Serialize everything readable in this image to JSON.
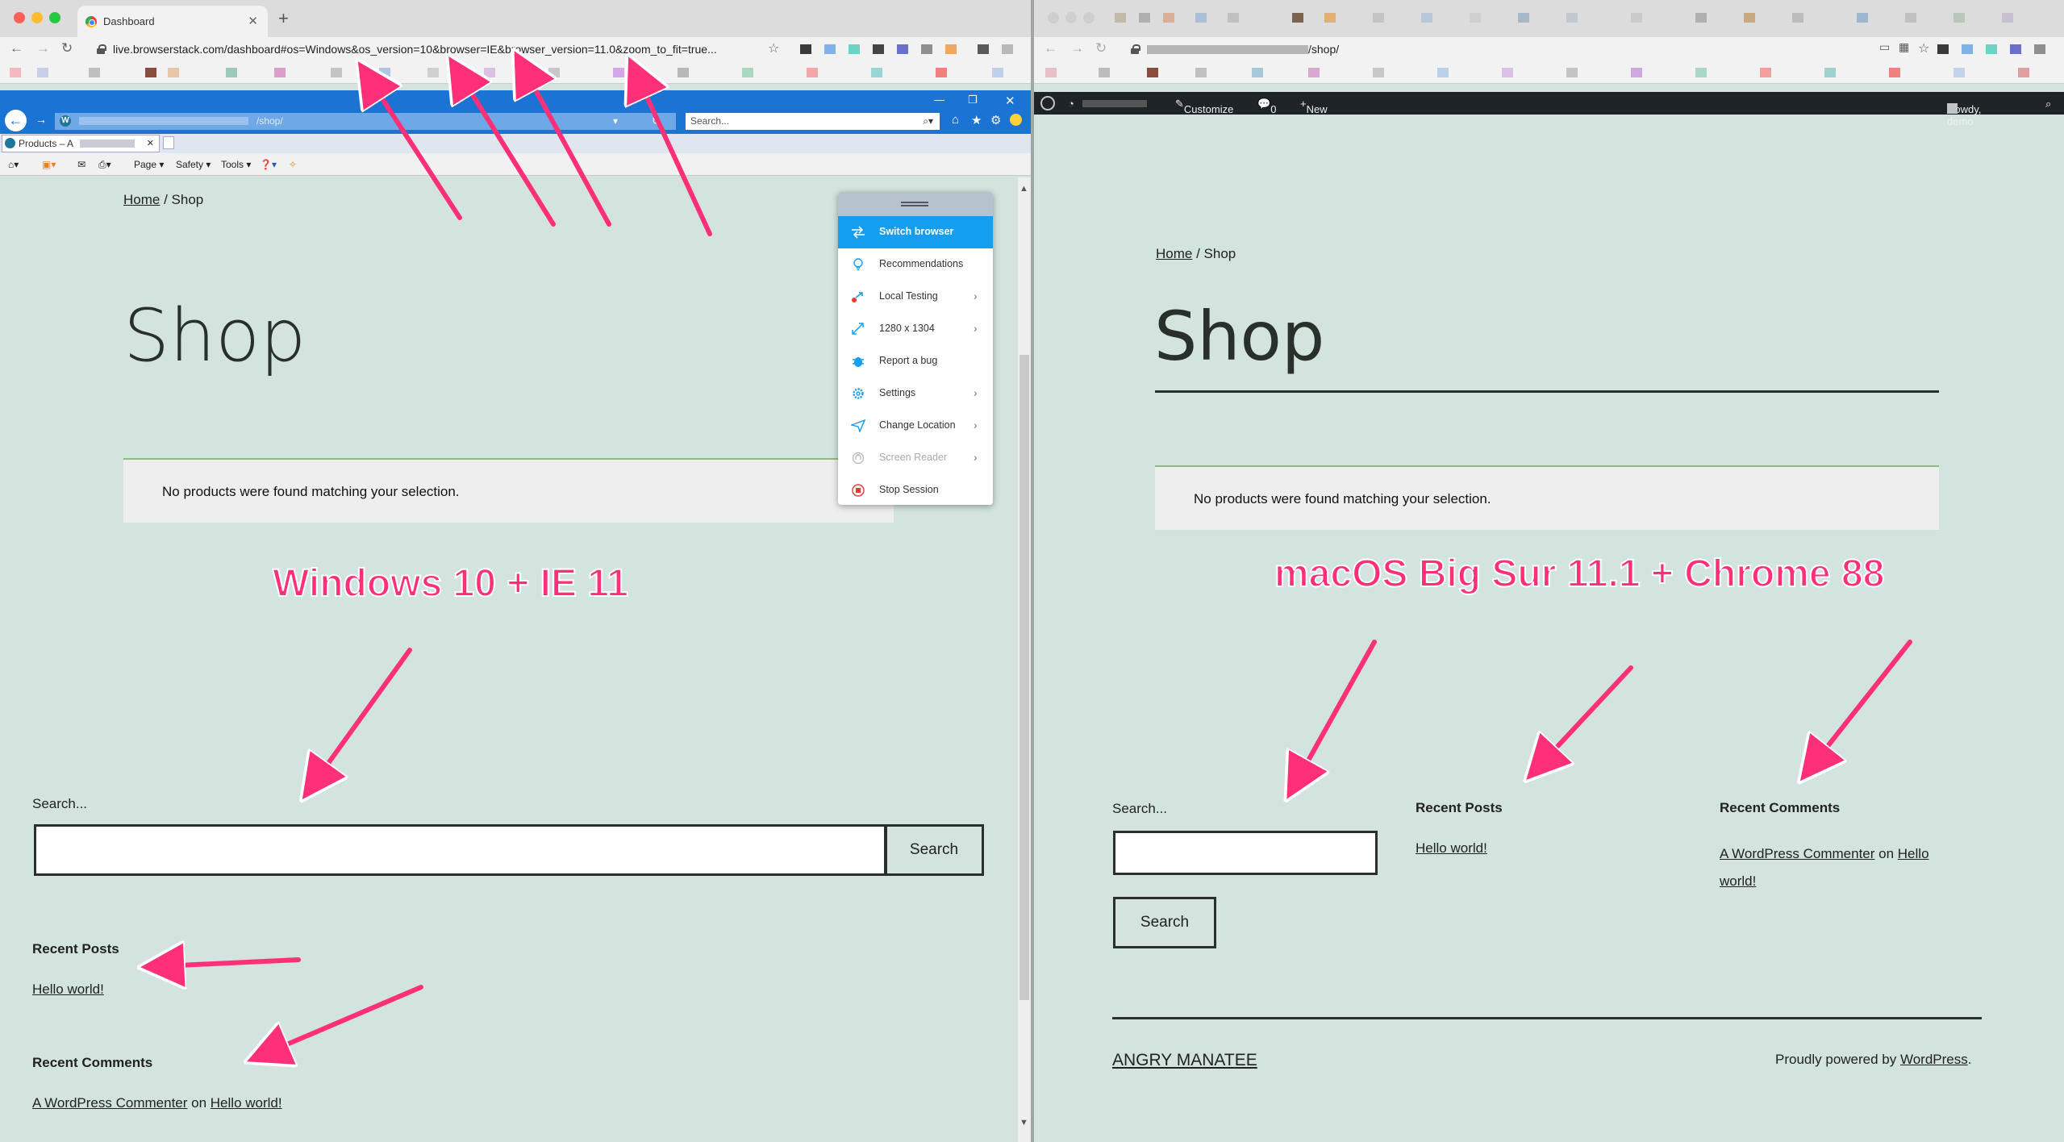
{
  "left": {
    "tab_title": "Dashboard",
    "address": "live.browserstack.com/dashboard#os=Windows&os_version=10&browser=IE&browser_version=11.0&zoom_to_fit=true...",
    "ie": {
      "address_tail": "/shop/",
      "search_placeholder": "Search...",
      "tab_title": "Products – A",
      "cmd_page": "Page",
      "cmd_safety": "Safety",
      "cmd_tools": "Tools"
    },
    "breadcrumb": {
      "home": "Home",
      "sep": " / ",
      "current": "Shop"
    },
    "heading": "Shop",
    "notice": "No products were found matching your selection.",
    "annotation": "Windows 10 + IE 11",
    "search_label": "Search...",
    "search_button": "Search",
    "recent_posts_heading": "Recent Posts",
    "recent_post_1": "Hello world!",
    "recent_comments_heading": "Recent Comments",
    "comment_author": "A WordPress Commenter",
    "comment_on": " on ",
    "comment_post": "Hello world!"
  },
  "bs_menu": {
    "items": [
      {
        "label": "Switch browser",
        "icon": "switch-icon",
        "chevron": ""
      },
      {
        "label": "Recommendations",
        "icon": "bulb-icon",
        "chevron": ""
      },
      {
        "label": "Local Testing",
        "icon": "local-testing-icon",
        "chevron": "›"
      },
      {
        "label": "1280 x 1304",
        "icon": "resize-icon",
        "chevron": "›"
      },
      {
        "label": "Report a bug",
        "icon": "bug-icon",
        "chevron": ""
      },
      {
        "label": "Settings",
        "icon": "gear-icon",
        "chevron": "›"
      },
      {
        "label": "Change Location",
        "icon": "location-icon",
        "chevron": "›"
      },
      {
        "label": "Screen Reader",
        "icon": "screen-reader-icon",
        "chevron": "›"
      },
      {
        "label": "Stop Session",
        "icon": "stop-icon",
        "chevron": ""
      }
    ],
    "colors": {
      "active": "#139ef0",
      "stop": "#e53935"
    }
  },
  "right": {
    "address_tail": "/shop/",
    "wpbar": {
      "customize": "Customize",
      "comments": "0",
      "new": "New",
      "howdy": "Howdy, demo"
    },
    "breadcrumb": {
      "home": "Home",
      "sep": " / ",
      "current": "Shop"
    },
    "heading": "Shop",
    "notice": "No products were found matching your selection.",
    "annotation": "macOS Big Sur 11.1 + Chrome 88",
    "search_label": "Search...",
    "search_button": "Search",
    "recent_posts_heading": "Recent Posts",
    "recent_post_1": "Hello world!",
    "recent_comments_heading": "Recent Comments",
    "comment_author": "A WordPress Commenter",
    "comment_on": " on ",
    "comment_post_1": "Hello",
    "comment_post_2": "world!",
    "site_title": "ANGRY MANATEE",
    "powered_prefix": "Proudly powered by ",
    "powered_link": "WordPress",
    "powered_suffix": "."
  },
  "colors": {
    "page_bg": "#d2e4dd",
    "annotation": "#ff2f78",
    "ie_blue": "#1b73d3"
  }
}
